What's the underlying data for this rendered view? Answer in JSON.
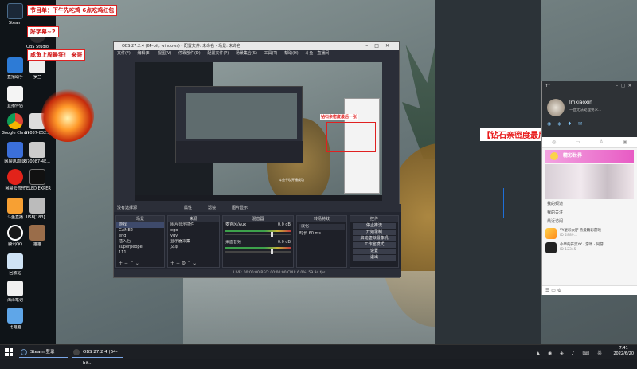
{
  "overlays": {
    "notice_1": "节目单：下午先吃鸡 6点吃鸡红包",
    "notice_2": "好字幕~2",
    "notice_3": "咸鱼上周最狂！ 来哥",
    "yy_banner_big": "【钻石亲密度最后一张拉！】"
  },
  "desktop_icons": [
    {
      "label": "Steam"
    },
    {
      "label": "OBS Studio"
    },
    {
      "label": "直播助手"
    },
    {
      "label": "罗兰"
    },
    {
      "label": "直播伴侣"
    },
    {
      "label": "Google Chrome"
    },
    {
      "label": "37087-852..."
    },
    {
      "label": "网易UU加速"
    },
    {
      "label": "370087-4E..."
    },
    {
      "label": "网易云音乐"
    },
    {
      "label": "YELED EXPER..."
    },
    {
      "label": "斗鱼直播"
    },
    {
      "label": "USB[183]..."
    },
    {
      "label": "腾讯QQ"
    },
    {
      "label": "猫猫"
    },
    {
      "label": "回收站"
    },
    {
      "label": "海泽笔记"
    },
    {
      "label": "比电脑"
    }
  ],
  "obs": {
    "title": "OBS 27.2.4 (64-bit, windows) - 配置文件: 未命名 - 场景: 未命名",
    "menu": [
      "文件(F)",
      "编辑(E)",
      "视图(V)",
      "停靠部件(D)",
      "配置文件(P)",
      "场景集合(S)",
      "工具(T)",
      "帮助(H)",
      "斗鱼 - 直播间"
    ],
    "preview_caption": "斗鱼千fp开播成功",
    "preview_red_text": "钻石亲密度最后一张",
    "dock_tabs": {
      "no_source": "没有选择源",
      "properties": "属性",
      "filters": "滤镜",
      "image_src": "图片显示"
    },
    "panels": {
      "scenes": {
        "title": "场景",
        "items": [
          "游戏",
          "GAME2",
          "end",
          "插入后",
          "superpeope",
          "111"
        ]
      },
      "sources": {
        "title": "来源",
        "items": [
          "图片显示插件",
          "ego",
          "ydy",
          "显示器采集",
          "文本"
        ]
      },
      "mixer": {
        "title": "混音器",
        "tracks": [
          {
            "name": "麦克风/Aux",
            "db": "0.0 dB"
          },
          {
            "name": "桌面音频",
            "db": "0.0 dB"
          }
        ]
      },
      "transitions": {
        "title": "转场特效",
        "type": "淡化",
        "duration_label": "时长",
        "duration": "60 ms"
      },
      "controls": {
        "title": "控件",
        "buttons": [
          "停止推流",
          "开始录制",
          "启动虚拟摄像机",
          "工作室模式",
          "设置",
          "退出"
        ]
      }
    },
    "status": "LIVE: 00:00:00   REC: 00:00:00   CPU: 6.0%, 59.94 fps"
  },
  "yy": {
    "title": "YY",
    "username": "lmxiaoxin",
    "subtitle": "一直无法处理要求...",
    "tabs": [
      "◎",
      "▭",
      "♙",
      "▣"
    ],
    "banner": "精彩世界",
    "section_1": "我的频道",
    "section_2": "我的关注",
    "section_3": "最近访问",
    "recent": [
      {
        "title": "YY星彩大厅·热爱精彩游戏",
        "sub": "ID 2889..."
      },
      {
        "title": "小帝的开黑YY · 游戏 · 同游...",
        "sub": "ID 12345"
      }
    ],
    "footer_icons": "☰  ▭  ⚙"
  },
  "taskbar": {
    "apps": [
      {
        "label": "Steam 登录"
      },
      {
        "label": "OBS 27.2.4 (64-bit..."
      }
    ],
    "time": "7:41",
    "date": "2022/6/20"
  }
}
